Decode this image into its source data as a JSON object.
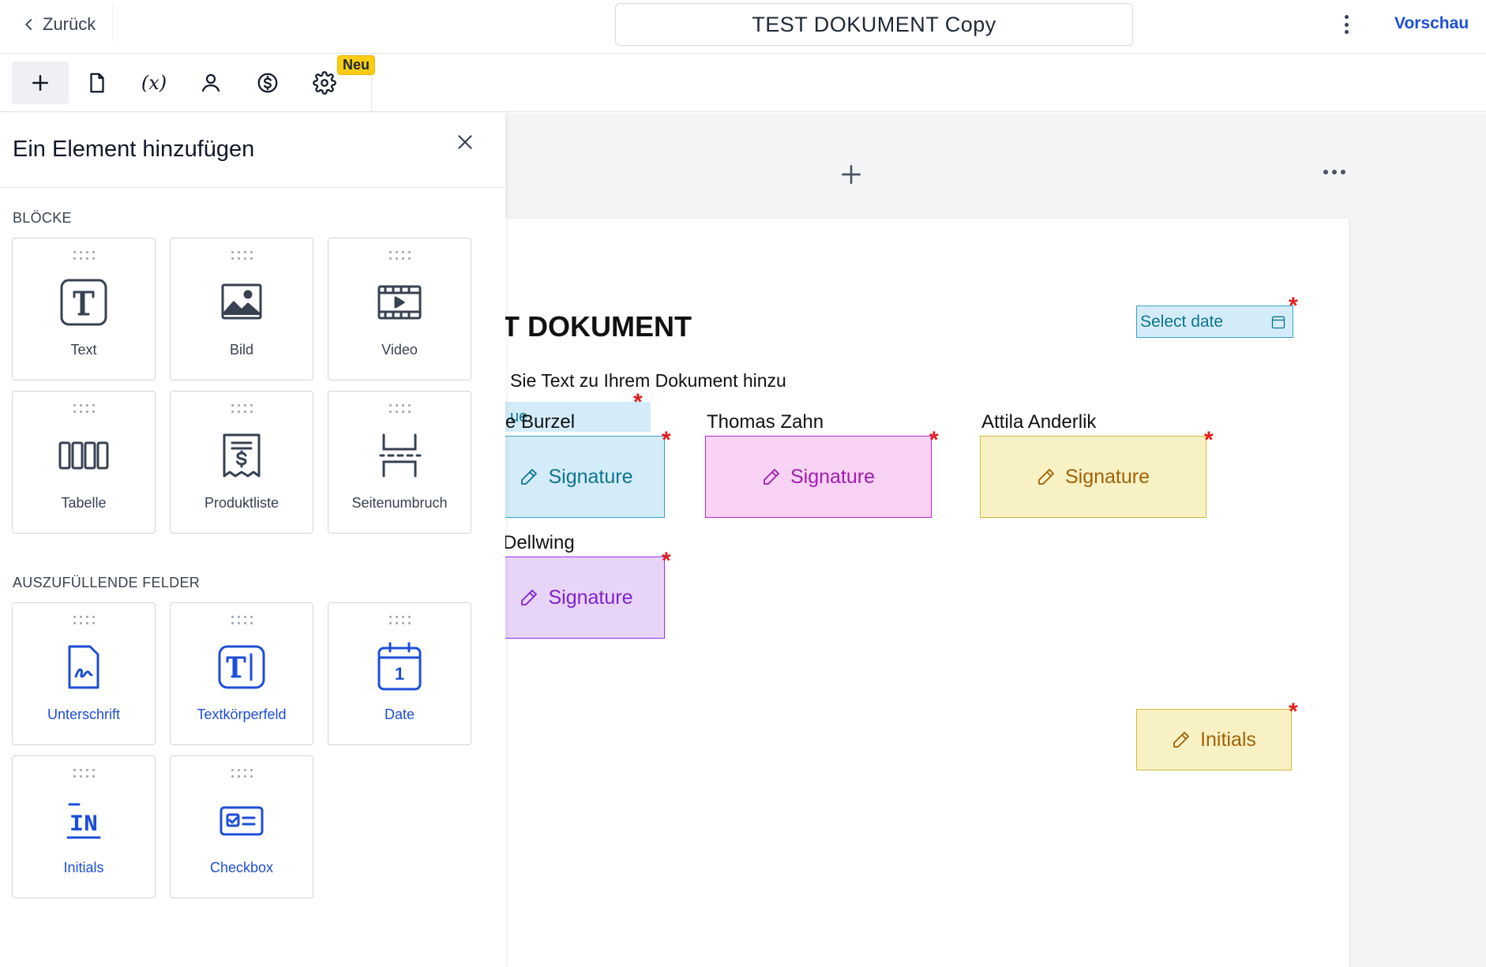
{
  "header": {
    "back_label": "Zurück",
    "document_title": "TEST DOKUMENT Copy",
    "preview_label": "Vorschau"
  },
  "toolbar": {
    "fx_label": "(x)",
    "new_badge": "Neu"
  },
  "panel": {
    "title": "Ein Element hinzufügen",
    "blocks_label": "BLÖCKE",
    "fields_label": "AUSZUFÜLLENDE FELDER",
    "blocks": [
      {
        "label": "Text",
        "icon": "text-block-icon"
      },
      {
        "label": "Bild",
        "icon": "image-icon"
      },
      {
        "label": "Video",
        "icon": "video-icon"
      },
      {
        "label": "Tabelle",
        "icon": "table-icon"
      },
      {
        "label": "Produktliste",
        "icon": "product-list-icon"
      },
      {
        "label": "Seitenumbruch",
        "icon": "page-break-icon"
      }
    ],
    "fields": [
      {
        "label": "Unterschrift",
        "icon": "signature-field-icon"
      },
      {
        "label": "Textkörperfeld",
        "icon": "text-field-icon"
      },
      {
        "label": "Date",
        "icon": "calendar-icon",
        "day": "1"
      },
      {
        "label": "Initials",
        "icon": "initials-icon",
        "glyph": "IN"
      },
      {
        "label": "Checkbox",
        "icon": "checkbox-icon"
      }
    ]
  },
  "document": {
    "heading": "T DOKUMENT",
    "subtext": "Sie Text zu Ihrem Dokument hinzu",
    "value_chip": "ue",
    "date_placeholder": "Select date",
    "required_mark": "*",
    "signers": [
      {
        "name": "e Burzel",
        "field": "Signature"
      },
      {
        "name": "Thomas Zahn",
        "field": "Signature"
      },
      {
        "name": "Attila Anderlik",
        "field": "Signature"
      },
      {
        "name": "Dellwing",
        "field": "Signature"
      }
    ],
    "initials_label": "Initials"
  },
  "colors": {
    "accent": "#1d4ed8",
    "sig_blue": "#d4ecf9",
    "sig_pink": "#f8d3f3",
    "sig_yellow": "#f8f1c4",
    "sig_purple": "#e8d4f8",
    "required": "#e11d1d",
    "badge": "#facc15"
  }
}
